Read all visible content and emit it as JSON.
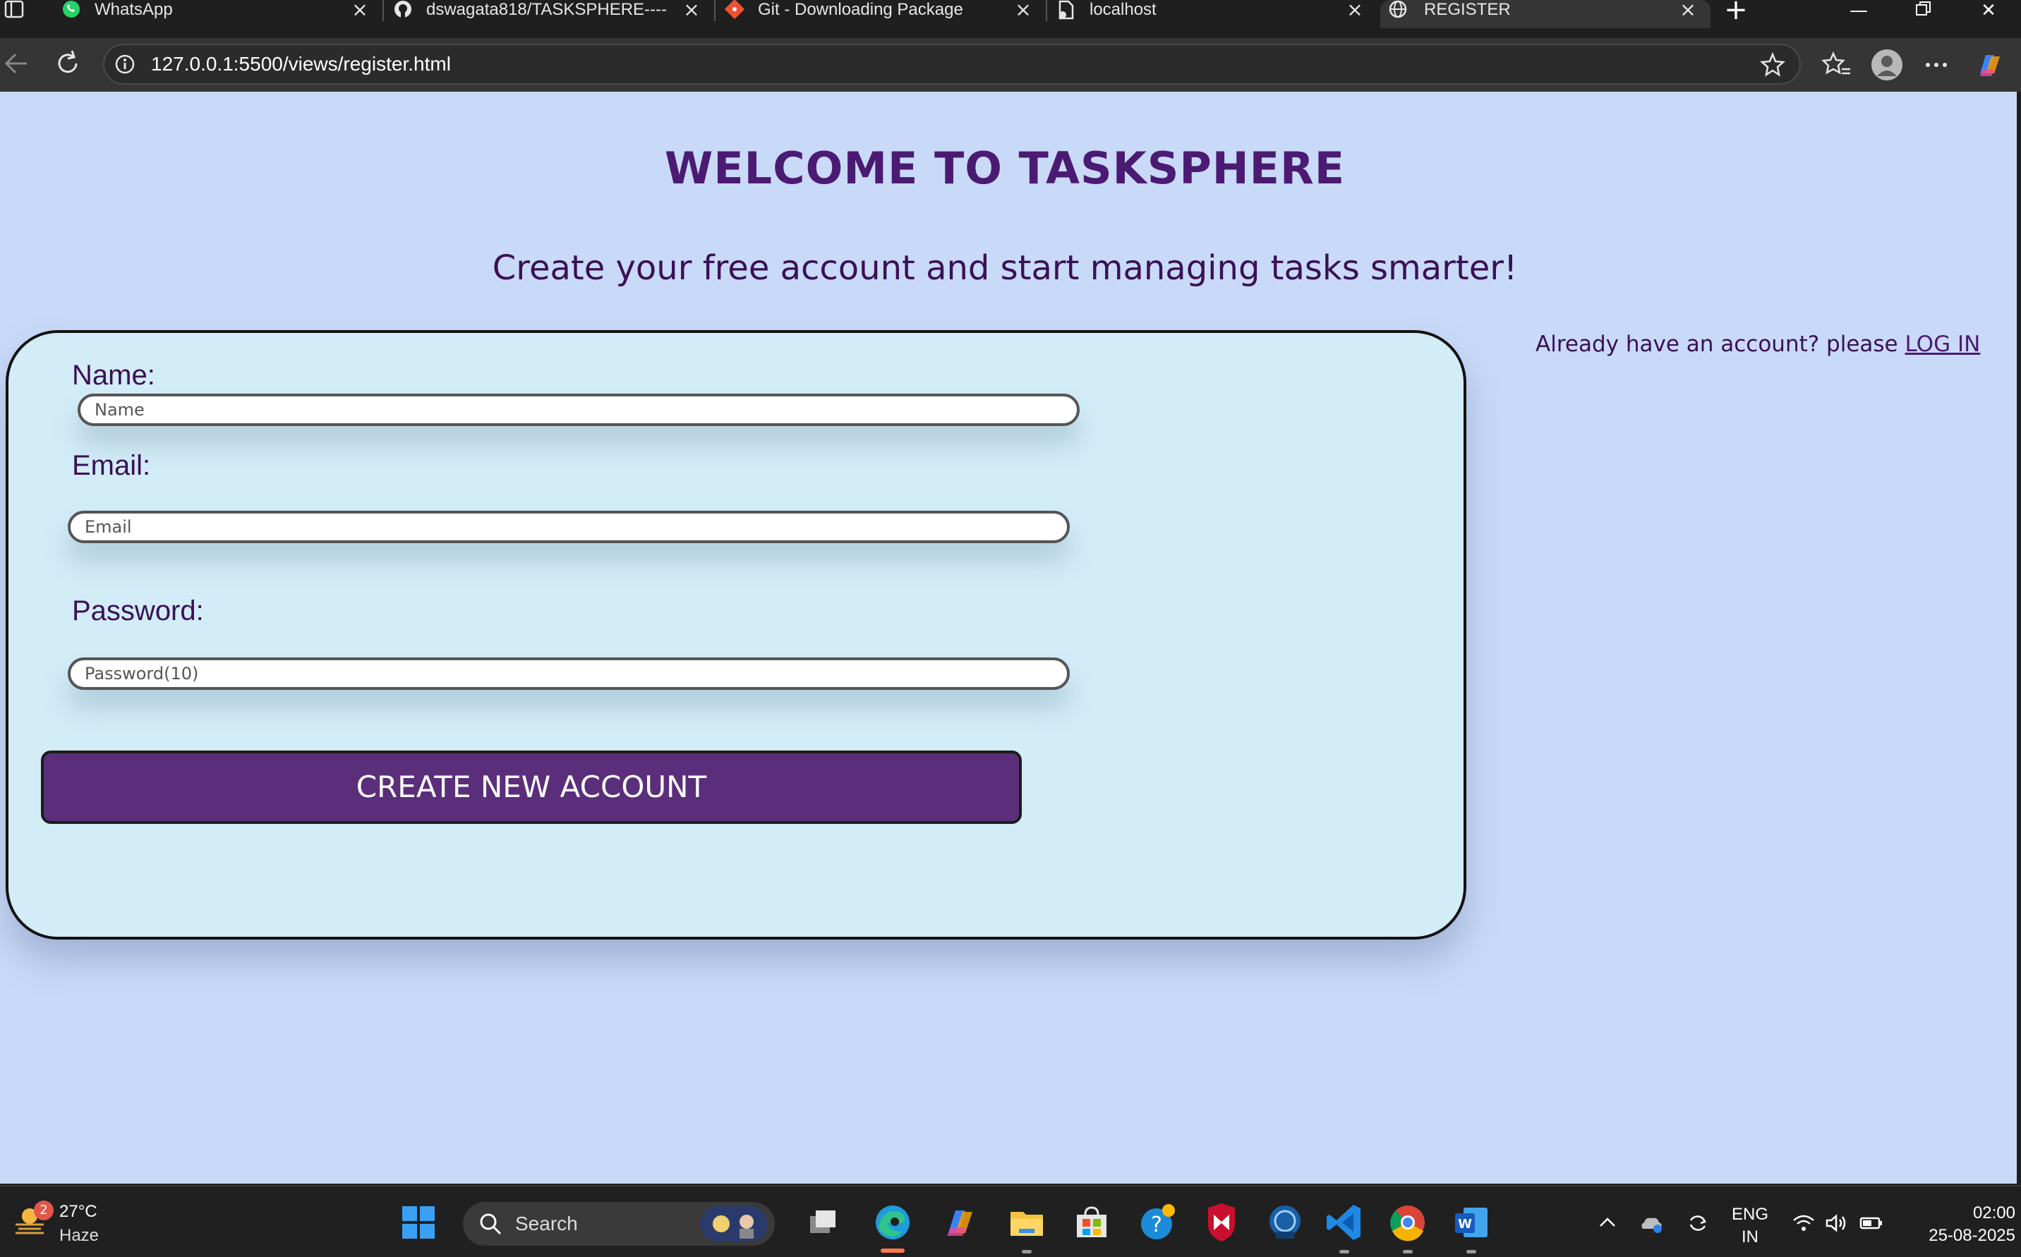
{
  "browser": {
    "tabs": [
      {
        "title": "WhatsApp",
        "icon": "whatsapp-icon"
      },
      {
        "title": "dswagata818/TASKSPHERE-----S",
        "icon": "github-icon"
      },
      {
        "title": "Git - Downloading Package",
        "icon": "git-icon"
      },
      {
        "title": "localhost",
        "icon": "document-icon"
      },
      {
        "title": "REGISTER",
        "icon": "globe-icon",
        "active": true
      }
    ],
    "url": "127.0.0.1:5500/views/register.html"
  },
  "page": {
    "title": "WELCOME TO TASKSPHERE",
    "subtitle": "Create your free account and start managing tasks smarter!",
    "login_prompt": "Already have an account? please ",
    "login_link": "LOG IN",
    "form": {
      "name_label": "Name:",
      "name_placeholder": "Name",
      "email_label": "Email:",
      "email_placeholder": "Email",
      "password_label": "Password:",
      "password_placeholder": "Password(10)",
      "submit_label": "CREATE NEW ACCOUNT"
    },
    "colors": {
      "background": "#c9daf8",
      "card": "#d2ecf8",
      "accent": "#5b2e7b",
      "title": "#4b1a72"
    }
  },
  "taskbar": {
    "weather_badge": "2",
    "weather_temp": "27°C",
    "weather_desc": "Haze",
    "search_label": "Search",
    "language": "ENG",
    "region": "IN",
    "time": "02:00",
    "date": "25-08-2025"
  }
}
